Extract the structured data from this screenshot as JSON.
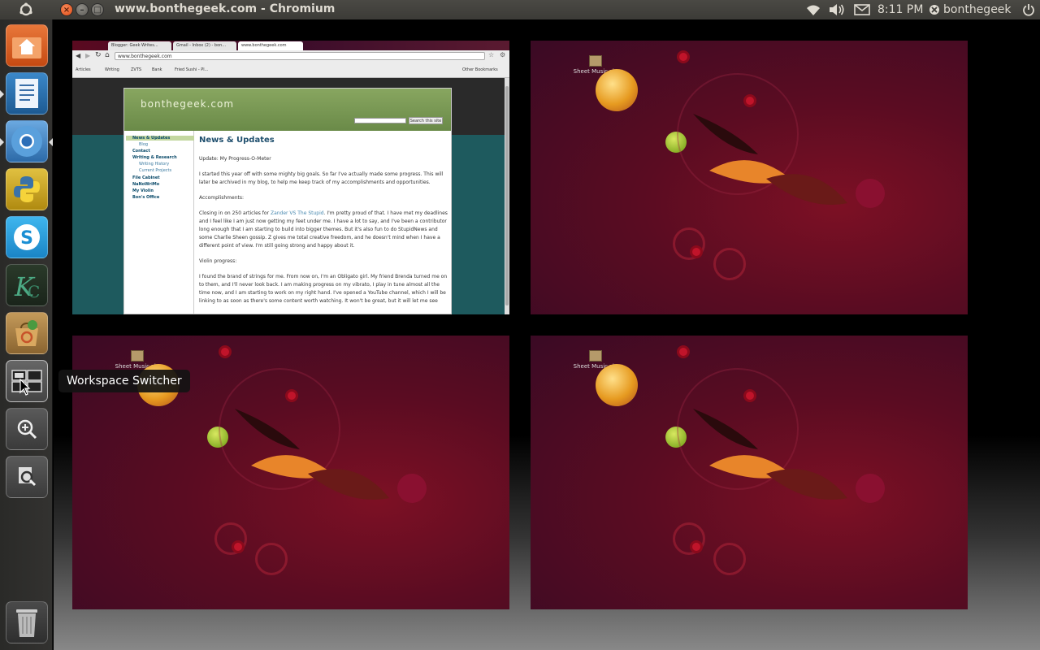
{
  "top_panel": {
    "window_title": "www.bonthegeek.com - Chromium",
    "clock": "8:11 PM",
    "user": "bonthegeek"
  },
  "launcher": {
    "items": [
      {
        "name": "Home Folder",
        "icon": "folder-home-icon"
      },
      {
        "name": "LibreOffice Writer",
        "icon": "writer-icon"
      },
      {
        "name": "Chromium Web Browser",
        "icon": "chromium-icon"
      },
      {
        "name": "Python",
        "icon": "python-icon"
      },
      {
        "name": "Skype",
        "icon": "skype-icon"
      },
      {
        "name": "KC",
        "icon": "kc-icon"
      },
      {
        "name": "Ubuntu Software Center",
        "icon": "software-center-icon"
      },
      {
        "name": "Workspace Switcher",
        "icon": "workspace-switcher-icon"
      },
      {
        "name": "Zoom In",
        "icon": "zoom-in-icon"
      },
      {
        "name": "Search",
        "icon": "search-files-icon"
      },
      {
        "name": "Trash",
        "icon": "trash-icon"
      }
    ],
    "tooltip": "Workspace Switcher"
  },
  "workspaces": {
    "desktop_icon_label": "Sheet Music.zip"
  },
  "browser": {
    "tabs": [
      "Blogger: Geek Writes...",
      "Gmail - Inbox (2) - bon...",
      "www.bonthegeek.com"
    ],
    "url": "www.bonthegeek.com",
    "bookmarks": [
      "Articles",
      "Writing",
      "ZVTS",
      "Bank",
      "Fried Sushi - Pl...",
      "Other Bookmarks"
    ],
    "site": {
      "logo": "bonthegeek.com",
      "search_button": "Search this site",
      "nav": [
        {
          "label": "News & Updates",
          "type": "active"
        },
        {
          "label": "Blog",
          "type": "sub"
        },
        {
          "label": "Contact",
          "type": "main"
        },
        {
          "label": "Writing & Research",
          "type": "main"
        },
        {
          "label": "Writing History",
          "type": "sub"
        },
        {
          "label": "Current Projects",
          "type": "sub"
        },
        {
          "label": "File Cabinet",
          "type": "main"
        },
        {
          "label": "NaNoWriMo",
          "type": "main"
        },
        {
          "label": "My Violin",
          "type": "main"
        },
        {
          "label": "Bon's Office",
          "type": "main"
        }
      ],
      "heading": "News & Updates",
      "post_title": "Update: My Progress-O-Meter",
      "p1": "I started this year off with some mighty big goals.  So far I've actually made some progress.  This will later be archived in my blog, to help me keep track of my accomplishments and opportunities.",
      "p2": "Accomplishments:",
      "p3_a": "Closing in on 250 articles for ",
      "p3_link": "Zander VS The Stupid",
      "p3_b": ".  I'm pretty proud of that.  I have met my deadlines and I feel like I am just now getting my feet under me.  I have a lot to say, and I've been a contributor long enough that I am starting to build into bigger themes.  But it's also fun to do StupidNews and some Charlie Sheen gossip.  Z gives me total creative freedom, and he doesn't mind when I have a different point of view.  I'm still going strong and happy about it.",
      "p4": "Violin progress:",
      "p5": "I found the brand of strings for me.  From now on, I'm an Obligato girl.  My friend Brenda turned me on to them, and I'll never look back.  I am making progress on my vibrato, I play in tune almost all the time now, and I am starting to work on my right hand.  I've opened a YouTube channel, which I will be linking to as soon as there's some content worth watching.  It won't be great, but it will let me see"
    }
  },
  "colors": {
    "panel_bg": "#3c3b37",
    "wallpaper": "#5a0c22",
    "site_green": "#7a9a54",
    "close_orange": "#e04c16"
  }
}
